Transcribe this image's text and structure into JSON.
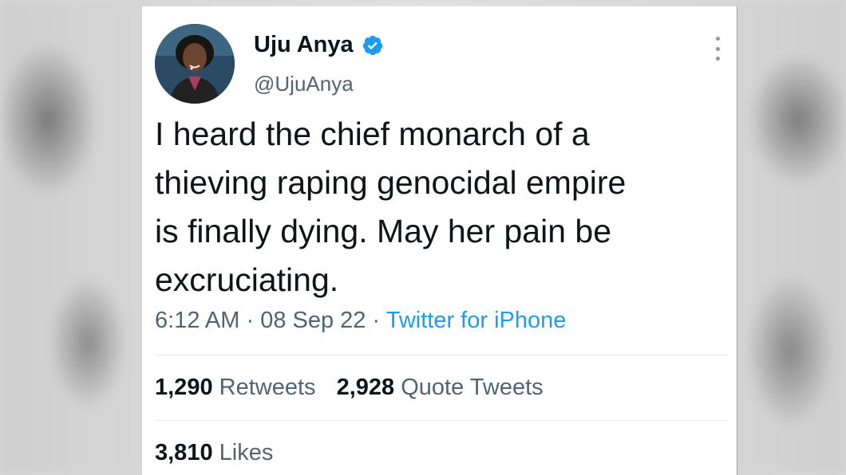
{
  "author": {
    "name": "Uju Anya",
    "handle": "@UjuAnya",
    "verified": true
  },
  "tweet": {
    "text": "I heard the chief monarch of a thieving raping genocidal empire is finally dying. May her pain be excruciating.",
    "lines": [
      "I heard the chief monarch of a",
      "thieving raping genocidal empire",
      "is finally dying. May her pain be",
      "excruciating."
    ],
    "time": "6:12 AM",
    "separator": "·",
    "date": "08 Sep 22",
    "source": "Twitter for iPhone"
  },
  "stats": {
    "retweets_count": "1,290",
    "retweets_label": "Retweets",
    "quotes_count": "2,928",
    "quotes_label": "Quote Tweets",
    "likes_count": "3,810",
    "likes_label": "Likes"
  },
  "colors": {
    "text": "#0f1419",
    "secondary": "#536471",
    "link": "#1d9bf0",
    "verified": "#1d9bf0"
  },
  "icons": {
    "verified": "verified-badge-icon",
    "more": "more-options-icon"
  }
}
